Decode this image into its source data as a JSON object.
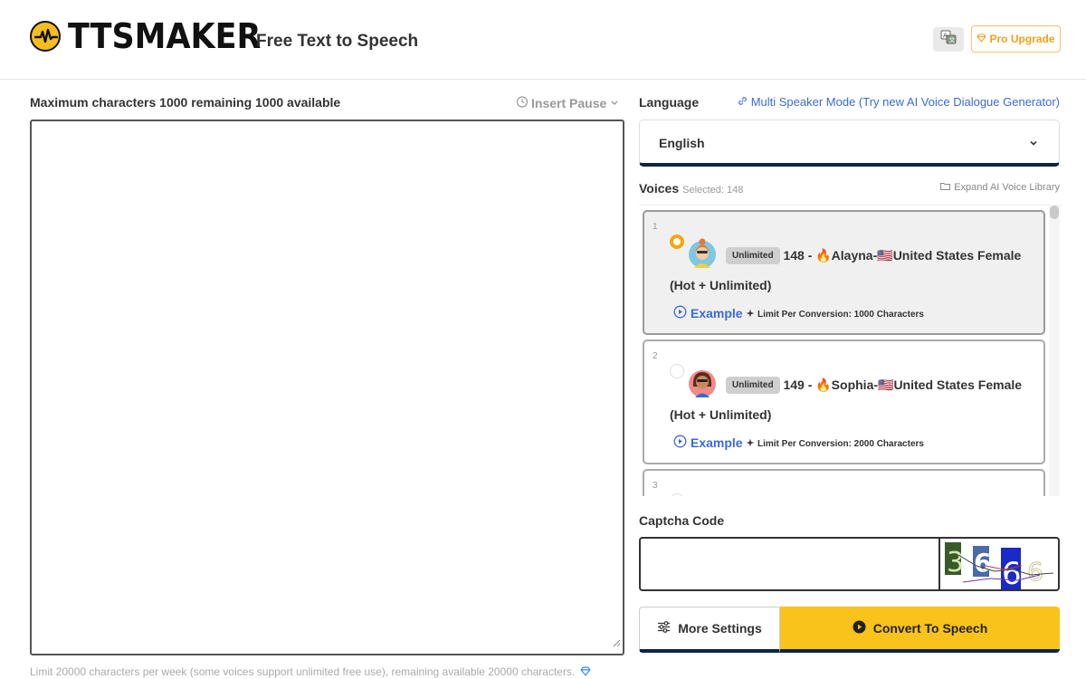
{
  "header": {
    "logo_text": "TTSMAKER",
    "title": "Free Text to Speech",
    "language_icon": "translate-icon",
    "pro_upgrade_label": "Pro Upgrade",
    "pro_upgrade_icon": "diamond-icon",
    "brand_color": "#f5bd1f"
  },
  "editor": {
    "char_info": "Maximum characters 1000 remaining 1000 available",
    "insert_pause_label": "Insert Pause",
    "text_value": "",
    "limit_note": "Limit 20000 characters per week (some voices support unlimited free use), remaining available 20000 characters."
  },
  "language": {
    "label": "Language",
    "multi_speaker_link": "Multi Speaker Mode (Try new AI Voice Dialogue Generator)",
    "selected": "English"
  },
  "voices": {
    "label": "Voices",
    "selected_text": "Selected: 148",
    "expand_label": "Expand AI Voice Library",
    "items": [
      {
        "num": "1",
        "badge": "Unlimited",
        "title": "148 - 🔥Alayna-🇺🇸United States Female (Hot + Unlimited)",
        "example": "Example",
        "limit": "Limit Per Conversion: 1000 Characters",
        "selected": true
      },
      {
        "num": "2",
        "badge": "Unlimited",
        "title": "149 - 🔥Sophia-🇺🇸United States Female (Hot + Unlimited)",
        "example": "Example",
        "limit": "Limit Per Conversion: 2000 Characters",
        "selected": false
      },
      {
        "num": "3",
        "selected": false
      }
    ]
  },
  "captcha": {
    "label": "Captcha Code",
    "value": "",
    "image_text": "3666"
  },
  "actions": {
    "more_settings_label": "More Settings",
    "convert_label": "Convert To Speech",
    "convert_color": "#f9c31b"
  }
}
